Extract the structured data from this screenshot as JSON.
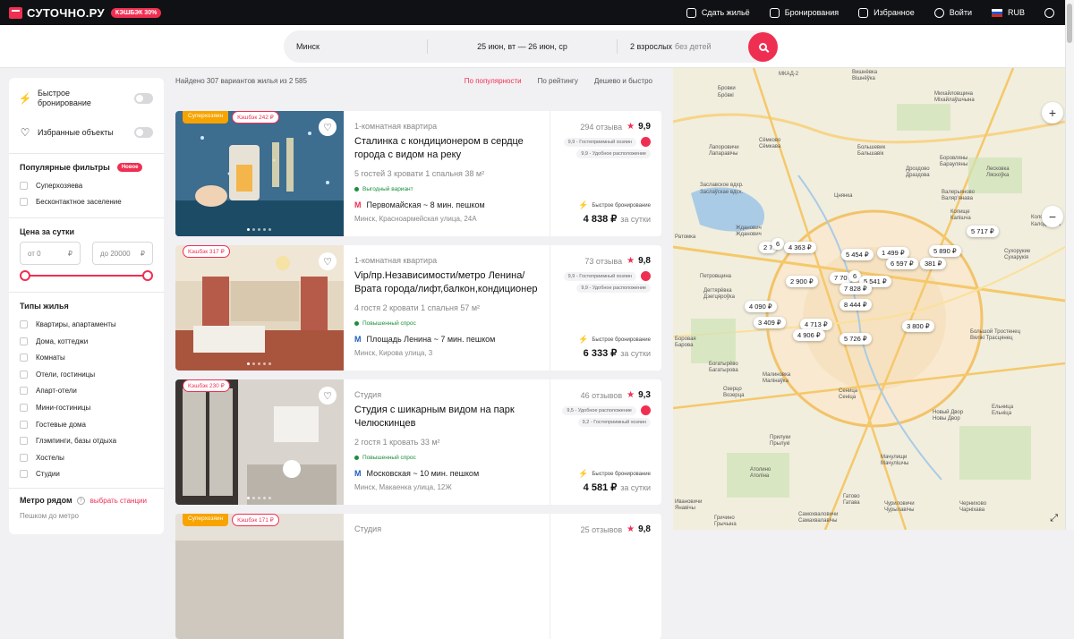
{
  "header": {
    "logo": "СУТОЧНО.РУ",
    "cashback": "КЭШБЭК 30%",
    "nav": [
      {
        "label": "Сдать жильё",
        "icon": "house-icon"
      },
      {
        "label": "Бронирования",
        "icon": "bookings-icon"
      },
      {
        "label": "Избранное",
        "icon": "favorites-icon"
      },
      {
        "label": "Войти",
        "icon": "user-icon"
      },
      {
        "label": "RUB",
        "icon": "flag-icon"
      }
    ]
  },
  "search": {
    "city": "Минск",
    "dates": "25 июн, вт — 26 июн, ср",
    "guests": "2 взрослых",
    "guests_muted": "без детей"
  },
  "sidebar": {
    "toggles": [
      {
        "label": "Быстрое бронирование"
      },
      {
        "label": "Избранные объекты"
      }
    ],
    "popular_title": "Популярные фильтры",
    "new_badge": "Новое",
    "popular": [
      "Суперхозяева",
      "Бесконтактное заселение"
    ],
    "price_title": "Цена за сутки",
    "price_from_prefix": "от",
    "price_from": "0",
    "price_to_prefix": "до",
    "price_to": "20000",
    "currency": "₽",
    "types_title": "Типы жилья",
    "types": [
      "Квартиры, апартаменты",
      "Дома, коттеджи",
      "Комнаты",
      "Отели, гостиницы",
      "Апарт-отели",
      "Мини-гостиницы",
      "Гостевые дома",
      "Глэмпинги, базы отдыха",
      "Хостелы",
      "Студии"
    ],
    "metro_title": "Метро рядом",
    "metro_link": "выбрать станции",
    "walk_label": "Пешком до метро"
  },
  "results": {
    "found": "Найдено 307 вариантов жилья из 2 585",
    "sort": [
      "По популярности",
      "По рейтингу",
      "Дешево и быстро"
    ],
    "cards": [
      {
        "badge_super": "Суперхозяин",
        "cashback": "Кэшбэк 242 ₽",
        "type": "1-комнатная квартира",
        "title": "Сталинка с кондиционером в сердце города с видом на реку",
        "meta": "5 гостей  3 кровати  1 спальня   38 м²",
        "tag": "Выгодный вариант",
        "metro": "Первомайская ~ 8 мин. пешком",
        "address": "Минск, Красноармейская улица, 24А",
        "reviews": "294 отзыва",
        "score": "9,9",
        "sub1": "9,9 - Гостеприимный хозяин",
        "sub2": "9,9 - Удобное расположение",
        "fast": "Быстрое бронирование",
        "price": "4 838 ₽",
        "per": "за сутки"
      },
      {
        "badge_super": "",
        "cashback": "Кэшбэк 317 ₽",
        "type": "1-комнатная квартира",
        "title": "Vip/пр.Независимости/метро Ленина/Врата города/лифт,балкон,кондиционер",
        "meta": "4 гостя  2 кровати  1 спальня   57 м²",
        "tag": "Повышенный спрос",
        "metro": "Площадь Ленина ~ 7 мин. пешком",
        "address": "Минск, Кирова улица, 3",
        "reviews": "73 отзыва",
        "score": "9,8",
        "sub1": "9,9 - Гостеприимный хозяин",
        "sub2": "9,9 - Удобное расположение",
        "fast": "Быстрое бронирование",
        "price": "6 333 ₽",
        "per": "за сутки"
      },
      {
        "badge_super": "",
        "cashback": "Кэшбэк 230 ₽",
        "type": "Студия",
        "title": "Студия с шикарным видом на парк Челюскинцев",
        "meta": "2 гостя  1 кровать   33 м²",
        "tag": "Повышенный спрос",
        "metro": "Московская ~ 10 мин. пешком",
        "address": "Минск, Макаенка улица, 12Ж",
        "reviews": "46 отзывов",
        "score": "9,3",
        "sub1": "9,5 - Удобное расположение",
        "sub2": "9,2 - Гостеприимный хозяин",
        "fast": "Быстрое бронирование",
        "price": "4 581 ₽",
        "per": "за сутки"
      },
      {
        "badge_super": "Суперхозяин",
        "cashback": "Кэшбэк 171 ₽",
        "type": "Студия",
        "reviews": "25 отзывов",
        "score": "9,8"
      }
    ]
  },
  "map": {
    "prices": [
      "5 454 ₽",
      "1 499 ₽",
      "5 890 ₽",
      "6 597 ₽",
      "381 ₽",
      "5 717 ₽",
      "2 7",
      "6",
      "4 363 ₽",
      "2 900 ₽",
      "7 70",
      "6",
      "5 541 ₽",
      "7 828 ₽",
      "4 090 ₽",
      "8 444 ₽",
      "3 409 ₽",
      "4 713 ₽",
      "4 906 ₽",
      "5 726 ₽",
      "3 800 ₽"
    ],
    "labels": [
      "МКАД-2",
      "Бровки",
      "Брόвкі",
      "Вишнёвка",
      "Вішнёўка",
      "Михайловщина",
      "Міхайлаўшчына",
      "Лапоровичи",
      "Лапаравічы",
      "Сёмково",
      "Сёмкава",
      "Большевик",
      "Бальшавік",
      "Боровляны",
      "Барауляны",
      "Заславское вдхр.",
      "Заслаўскае вдсх.",
      "Цнянка",
      "Дроздово",
      "Драздова",
      "Лесковка",
      "Ляскоўка",
      "Валерьяново",
      "Валяр'янава",
      "Копище",
      "Капішча",
      "Колодищи",
      "Калодзішчы",
      "Ратомка",
      "Жданович",
      "Жданович",
      "Сухорукие",
      "Сухарукія",
      "Петровщина",
      "Дегтярёвка",
      "Дзегцярoўка",
      "Боровая",
      "Барова",
      "Богатырёво",
      "Багатырова",
      "Малиновка",
      "Малінаўка",
      "Озерцо",
      "Возерца",
      "Сеница",
      "Сеніца",
      "Большой Тростенец",
      "Вялікі Трасцянец",
      "Новый Двор",
      "Новы Двор",
      "Ельница",
      "Ельніца",
      "Прилуки",
      "Прылукі",
      "Мачулищи",
      "Мачулішчы",
      "Атолино",
      "Атоліна",
      "Гатово",
      "Гатава",
      "Самохваловичи",
      "Самахвалавічы",
      "Чуриловичи",
      "Чурылавічы",
      "Чернихово",
      "Чарніхава",
      "Гричино",
      "Грычына",
      "Ивановичи",
      "Янавічы"
    ],
    "zoom_in": "+",
    "zoom_out": "−"
  }
}
